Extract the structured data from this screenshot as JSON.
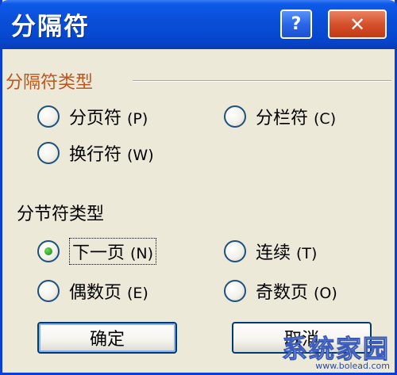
{
  "window": {
    "title": "分隔符",
    "help_label": "?",
    "close_label": "✕"
  },
  "break_types": {
    "label": "分隔符类型",
    "options": [
      {
        "label": "分页符",
        "hotkey": "(P)",
        "checked": false
      },
      {
        "label": "分栏符",
        "hotkey": "(C)",
        "checked": false
      },
      {
        "label": "换行符",
        "hotkey": "(W)",
        "checked": false
      }
    ]
  },
  "section_types": {
    "label": "分节符类型",
    "options": [
      {
        "label": "下一页",
        "hotkey": "(N)",
        "checked": true
      },
      {
        "label": "连续",
        "hotkey": "(T)",
        "checked": false
      },
      {
        "label": "偶数页",
        "hotkey": "(E)",
        "checked": false
      },
      {
        "label": "奇数页",
        "hotkey": "(O)",
        "checked": false
      }
    ]
  },
  "buttons": {
    "ok": "确定",
    "cancel": "取消"
  },
  "watermark": {
    "main": "系统家园",
    "url": "www.bolead.com"
  }
}
